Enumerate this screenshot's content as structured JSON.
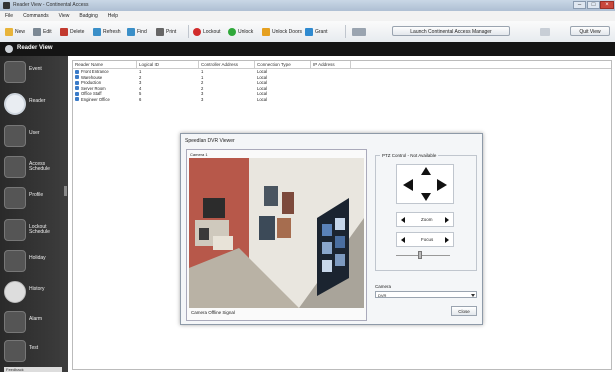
{
  "window": {
    "title": "Reader View - Continental Access"
  },
  "menu": {
    "items": [
      "File",
      "Commands",
      "View",
      "Badging",
      "Help"
    ]
  },
  "toolbar": {
    "new_label": "New",
    "edit_label": "Edit",
    "delete_label": "Delete",
    "refresh_label": "Refresh",
    "find_label": "Find",
    "print_label": "Print",
    "lockout_label": "Lockout",
    "unlock_label": "Unlock",
    "unlock_doors_label": "Unlock Doors",
    "grant_label": "Grant",
    "launch_manager_label": "Launch Continental Access Manager",
    "quit_label": "Quit View"
  },
  "section": {
    "title": "Reader View"
  },
  "sidebar": {
    "items": [
      {
        "label": "Event"
      },
      {
        "label": "Reader"
      },
      {
        "label": "User"
      },
      {
        "label": "Access Schedule"
      },
      {
        "label": "Profile"
      },
      {
        "label": "Lockout Schedule"
      },
      {
        "label": "Holiday"
      },
      {
        "label": "History"
      },
      {
        "label": "Alarm"
      },
      {
        "label": "Test"
      }
    ],
    "footer": "Feedback"
  },
  "table": {
    "columns": [
      "Reader Name",
      "Logical ID",
      "Controller Address",
      "Connection Type",
      "IP Address"
    ],
    "rows": [
      [
        "Front Entrance",
        "1",
        "1",
        "Local",
        ""
      ],
      [
        "Warehouse",
        "2",
        "1",
        "Local",
        ""
      ],
      [
        "Production",
        "3",
        "2",
        "Local",
        ""
      ],
      [
        "Server Room",
        "4",
        "2",
        "Local",
        ""
      ],
      [
        "Office Staff",
        "5",
        "3",
        "Local",
        ""
      ],
      [
        "Engineer Office",
        "6",
        "3",
        "Local",
        ""
      ]
    ]
  },
  "dialog": {
    "title": "Speedlan DVR Viewer",
    "camera_label": "Camera 1",
    "video_status": "Camera Offline Signal",
    "ptz_title": "PTZ Control - Not Available",
    "zoom_label": "Zoom",
    "focus_label": "Focus",
    "preset_label": "Camera",
    "preset_value": "DVR",
    "close_label": "Close"
  },
  "colors": {
    "accent": "#3a7bc8",
    "header_bg": "#141414"
  }
}
